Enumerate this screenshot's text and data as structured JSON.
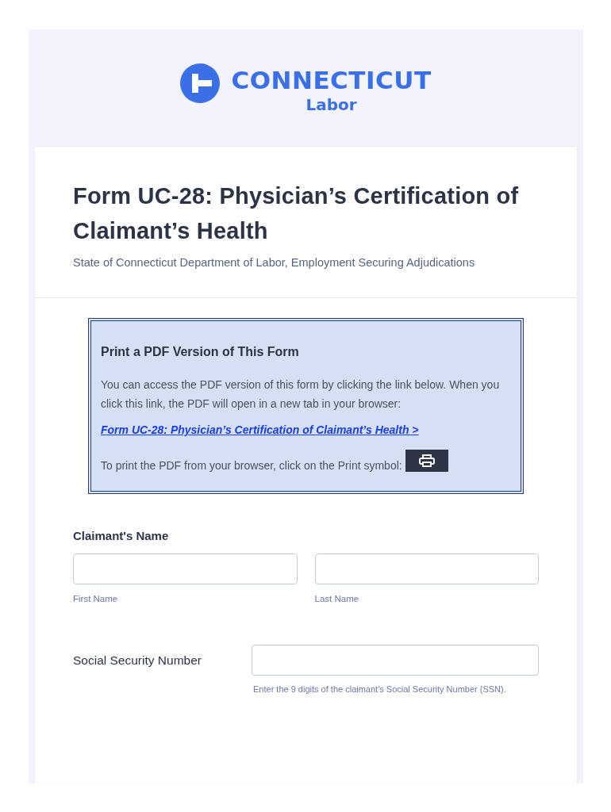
{
  "logo": {
    "name": "CONNECTICUT",
    "subtitle": "Labor"
  },
  "header": {
    "title": "Form UC-28: Physician’s Certification of Claimant’s Health",
    "subtitle": "State of Connecticut Department of Labor, Employment Securing Adjudications"
  },
  "info_box": {
    "heading": "Print a PDF Version of This Form",
    "text": "You can access the PDF version of this form by clicking the link below. When you click this link, the PDF will open in a new tab in your browser:",
    "link": "Form UC-28: Physician’s Certification of Claimant’s Health >",
    "print_text": "To print the PDF from your browser, click on the Print symbol:"
  },
  "claimant_name": {
    "label": "Claimant's Name",
    "fields": [
      {
        "sublabel": "First Name"
      },
      {
        "sublabel": "Last Name"
      }
    ]
  },
  "ssn": {
    "label": "Social Security Number",
    "hint": "Enter the 9 digits of the claimant's Social Security Number (SSN)."
  }
}
